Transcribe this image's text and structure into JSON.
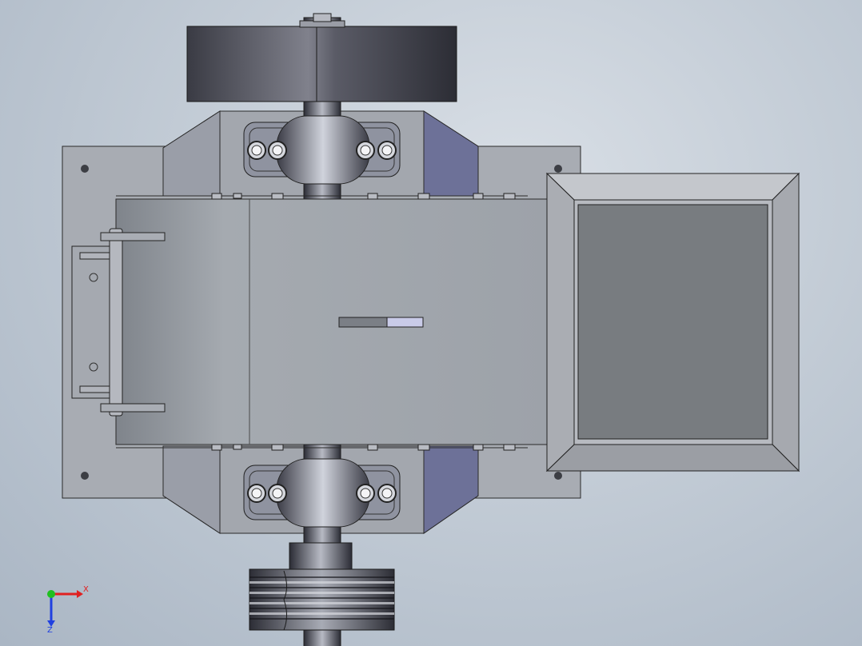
{
  "viewport": {
    "background_top": "#d9dfe6",
    "background_bottom": "#aab6c4"
  },
  "triad": {
    "x_label": "X",
    "z_label": "Z",
    "x_color": "#e02020",
    "y_color": "#20c020",
    "z_color": "#2040e0"
  },
  "model": {
    "body_color": "#9ea3aa",
    "hopper_color": "#7a7e82",
    "shaft_color": "#6e6f7a",
    "flywheel_color": "#4a4b55",
    "housing_color": "#7c7f9e"
  }
}
